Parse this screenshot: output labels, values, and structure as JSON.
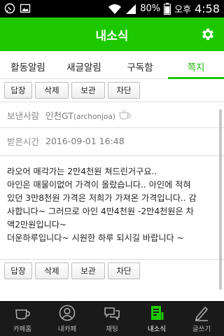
{
  "status_bar": {
    "battery_percent": "80%",
    "ampm": "오후",
    "time": "4:58",
    "icons": [
      "whatsapp-icon",
      "image-icon",
      "wifi-icon",
      "signal-icon",
      "battery-icon"
    ]
  },
  "header": {
    "title": "내소식",
    "settings_icon": "gear-icon"
  },
  "tabs": [
    {
      "label": "활동알림",
      "active": false
    },
    {
      "label": "새글알림",
      "active": false
    },
    {
      "label": "구독함",
      "active": false
    },
    {
      "label": "쪽지",
      "active": true
    }
  ],
  "actions": {
    "reply": "답장",
    "delete": "삭제",
    "save": "보관",
    "block": "차단"
  },
  "message": {
    "sender_label": "보낸사람",
    "sender_name": "인천GT",
    "sender_id": "(archonjoa)",
    "time_label": "받은시간",
    "received_time": "2016-09-01 16:48",
    "body_lines": [
      "라오어 매각가는 2만4천원 쳐드린거구요..",
      "아인은 매물이없어 가격이 올랐습니다.. 아인에 적혀",
      "있던 3만8천원 가격은 저희가 가져온 가격입니다.. 감",
      "사합니다~ 그러므로 아인 4만4천원 -2만4천원은 차",
      "액2만원입니다~",
      "더운하루입니다~ 시원한 하루 되시길 바랍니다 ~"
    ]
  },
  "bottom_nav": [
    {
      "label": "카페홈",
      "icon": "cafe-cup-icon",
      "active": false
    },
    {
      "label": "내카페",
      "icon": "profile-icon",
      "active": false
    },
    {
      "label": "채팅",
      "icon": "chat-icon",
      "active": false
    },
    {
      "label": "내소식",
      "icon": "news-icon",
      "active": true
    },
    {
      "label": "글쓰기",
      "icon": "pencil-icon",
      "active": false
    }
  ],
  "colors": {
    "brand_green": "#1ec800",
    "active_tab": "#19b800",
    "bottom_bar": "#1a1a1a"
  }
}
